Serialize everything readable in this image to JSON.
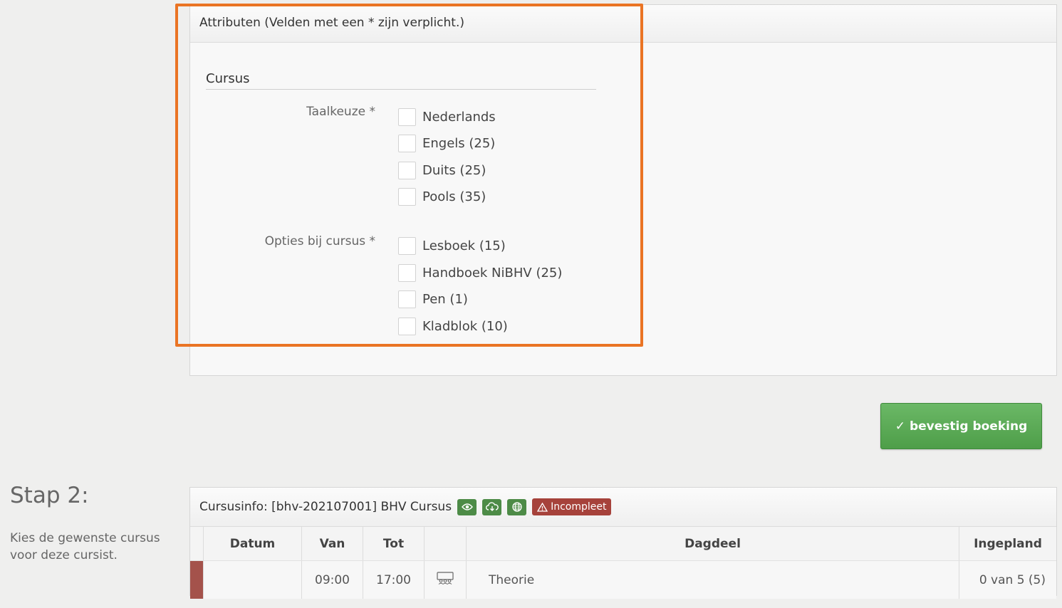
{
  "attributes": {
    "title": "Attributen (Velden met een * zijn verplicht.)",
    "section": "Cursus",
    "fields": [
      {
        "label": "Taalkeuze *",
        "options": [
          "Nederlands",
          "Engels (25)",
          "Duits (25)",
          "Pools (35)"
        ]
      },
      {
        "label": "Opties bij cursus *",
        "options": [
          "Lesboek (15)",
          "Handboek NiBHV (25)",
          "Pen (1)",
          "Kladblok (10)"
        ]
      }
    ]
  },
  "confirm_label": "bevestig boeking",
  "step": {
    "title": "Stap 2:",
    "description": "Kies de gewenste cursus voor deze cursist."
  },
  "course": {
    "title": "Cursusinfo: [bhv-202107001] BHV Cursus",
    "badge": "Incompleet",
    "columns": [
      "Datum",
      "Van",
      "Tot",
      "",
      "Dagdeel",
      "Ingepland"
    ],
    "rows": [
      {
        "datum": "",
        "van": "09:00",
        "tot": "17:00",
        "dagdeel": "Theorie",
        "ingepland": "0 van 5 (5)"
      }
    ]
  },
  "colors": {
    "accent_green": "#4e9e49",
    "highlight": "#ea7424",
    "badge_red": "#a6423b"
  }
}
